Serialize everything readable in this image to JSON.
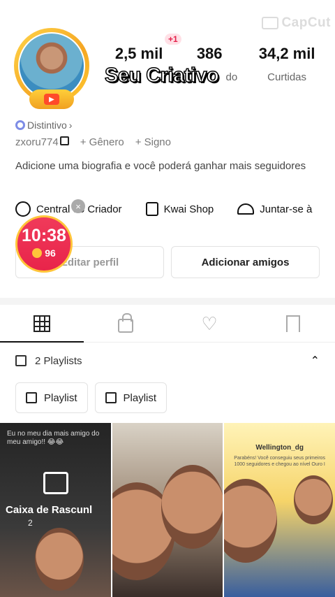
{
  "watermark": "CapCut",
  "overlay_title": "Seu Criativo",
  "stats": [
    {
      "value": "2,5 mil",
      "label": ""
    },
    {
      "value": "386",
      "label": "do"
    },
    {
      "value": "34,2 mil",
      "label": "Curtidas"
    }
  ],
  "plus_badge": "+1",
  "distintivo": "Distintivo",
  "username": "zxoru774",
  "gender_label": "+ Gênero",
  "sign_label": "+ Signo",
  "bio": "Adicione uma biografia e você poderá ganhar mais seguidores",
  "creator_links": [
    {
      "label": "Central do Criador",
      "icon": "bolt-icon"
    },
    {
      "label": "Kwai Shop",
      "icon": "bag-icon"
    },
    {
      "label": "Juntar-se à",
      "icon": "dome-icon"
    }
  ],
  "buttons": {
    "edit_profile": "Editar perfil",
    "add_friends": "Adicionar amigos"
  },
  "timer": {
    "time": "10:38",
    "coins": "96"
  },
  "close_glyph": "×",
  "tabs": [
    "grid-icon",
    "lock-icon",
    "heart-icon",
    "bookmark-icon"
  ],
  "playlists": {
    "count_label": "2 Playlists",
    "chips": [
      "Playlist",
      "Playlist"
    ]
  },
  "thumbnails": [
    {
      "caption": "Eu no meu dia mais amigo do meu amigo!! 😂😂",
      "label": "Caixa de Rascunl",
      "sub": "2"
    },
    {
      "caption": ""
    },
    {
      "user": "Wellington_dg",
      "message": "Parabéns! Você conseguiu seus primeiros 1000 seguidores e chegou ao nível Ouro I"
    }
  ]
}
